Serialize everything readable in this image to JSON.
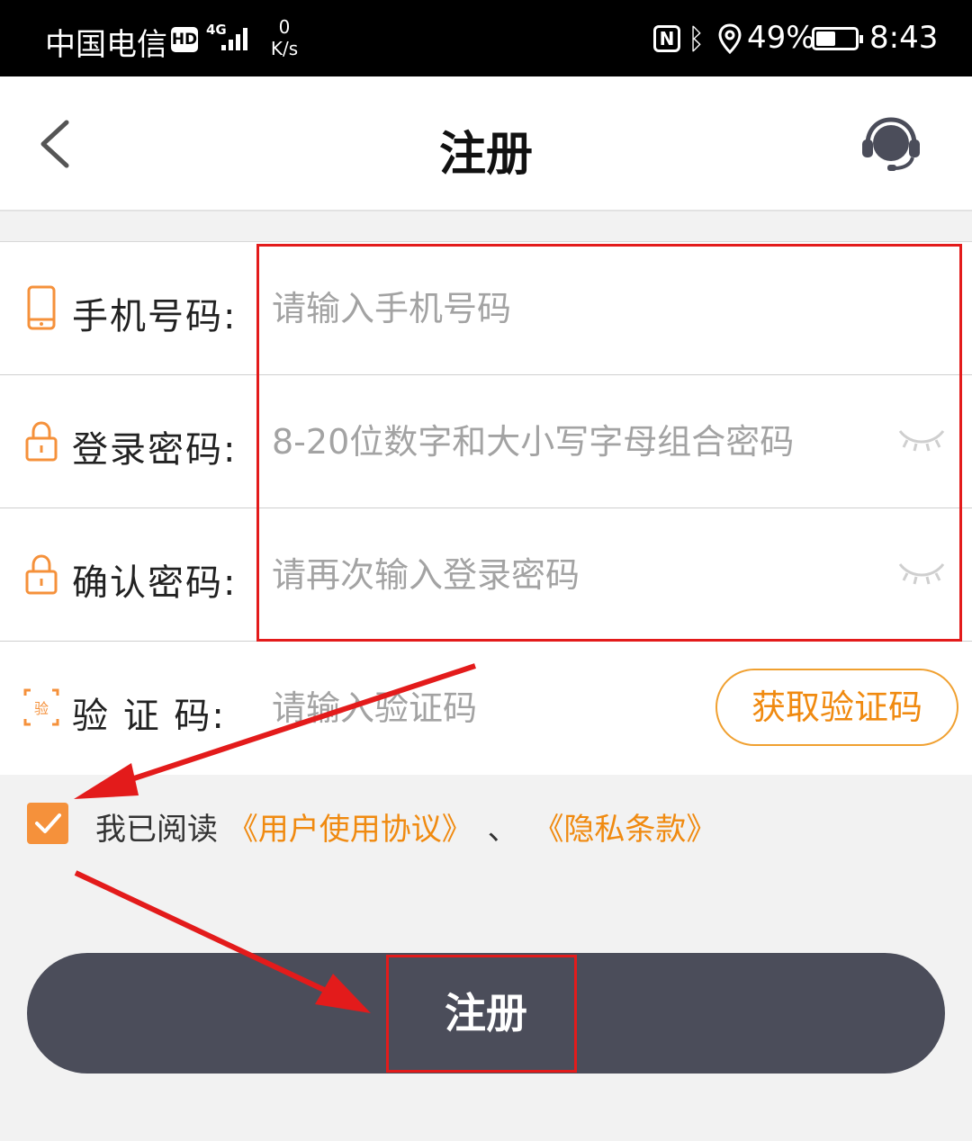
{
  "status_bar": {
    "carrier": "中国电信",
    "hd": "HD",
    "network": "4G",
    "speed_value": "0",
    "speed_unit": "K/s",
    "battery_percent": "49%",
    "battery_level": 0.49,
    "time": "8:43",
    "nfc": "N"
  },
  "header": {
    "title": "注册",
    "back_icon": "chevron-left-icon",
    "service_icon": "headset-icon"
  },
  "form": {
    "phone": {
      "label": "手机号码:",
      "placeholder": "请输入手机号码",
      "icon": "phone-icon"
    },
    "password": {
      "label": "登录密码:",
      "placeholder": "8-20位数字和大小写字母组合密码",
      "icon": "lock-icon"
    },
    "confirm": {
      "label": "确认密码:",
      "placeholder": "请再次输入登录密码",
      "icon": "lock-icon"
    },
    "code": {
      "label": "验 证 码:",
      "placeholder": "请输入验证码",
      "icon": "verify-code-icon",
      "button": "获取验证码"
    }
  },
  "agreement": {
    "checked": true,
    "prefix": "我已阅读",
    "link1": "《用户使用协议》",
    "separator": "、",
    "link2": "《隐私条款》"
  },
  "register_button": "注册",
  "colors": {
    "accent": "#f08a10",
    "checkbox": "#f5913b",
    "button": "#4b4d5a",
    "highlight": "#e31b1b"
  }
}
